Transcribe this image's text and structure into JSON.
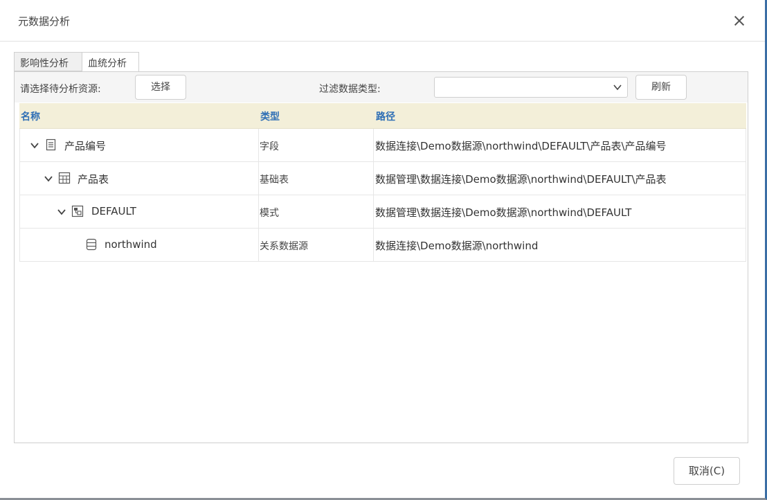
{
  "dialog": {
    "title": "元数据分析",
    "cancel_label": "取消(C)"
  },
  "tabs": [
    {
      "label": "影响性分析",
      "active": false
    },
    {
      "label": "血统分析",
      "active": true
    }
  ],
  "toolbar": {
    "resource_label": "请选择待分析资源:",
    "choose_label": "选择",
    "filter_label": "过滤数据类型:",
    "filter_value": "",
    "refresh_label": "刷新"
  },
  "table": {
    "columns": [
      "名称",
      "类型",
      "路径"
    ],
    "rows": [
      {
        "name": "产品编号",
        "type": "字段",
        "path": "数据连接\\Demo数据源\\northwind\\DEFAULT\\产品表\\产品编号",
        "icon": "field-icon",
        "expanded": true
      },
      {
        "name": "产品表",
        "type": "基础表",
        "path": "数据管理\\数据连接\\Demo数据源\\northwind\\DEFAULT\\产品表",
        "icon": "table-icon",
        "expanded": true
      },
      {
        "name": "DEFAULT",
        "type": "模式",
        "path": "数据管理\\数据连接\\Demo数据源\\northwind\\DEFAULT",
        "icon": "schema-icon",
        "expanded": true
      },
      {
        "name": "northwind",
        "type": "关系数据源",
        "path": "数据连接\\Demo数据源\\northwind",
        "icon": "database-icon",
        "expanded": false
      }
    ]
  },
  "colors": {
    "header_bg": "#f3efd9",
    "header_text": "#2f6fb5"
  }
}
